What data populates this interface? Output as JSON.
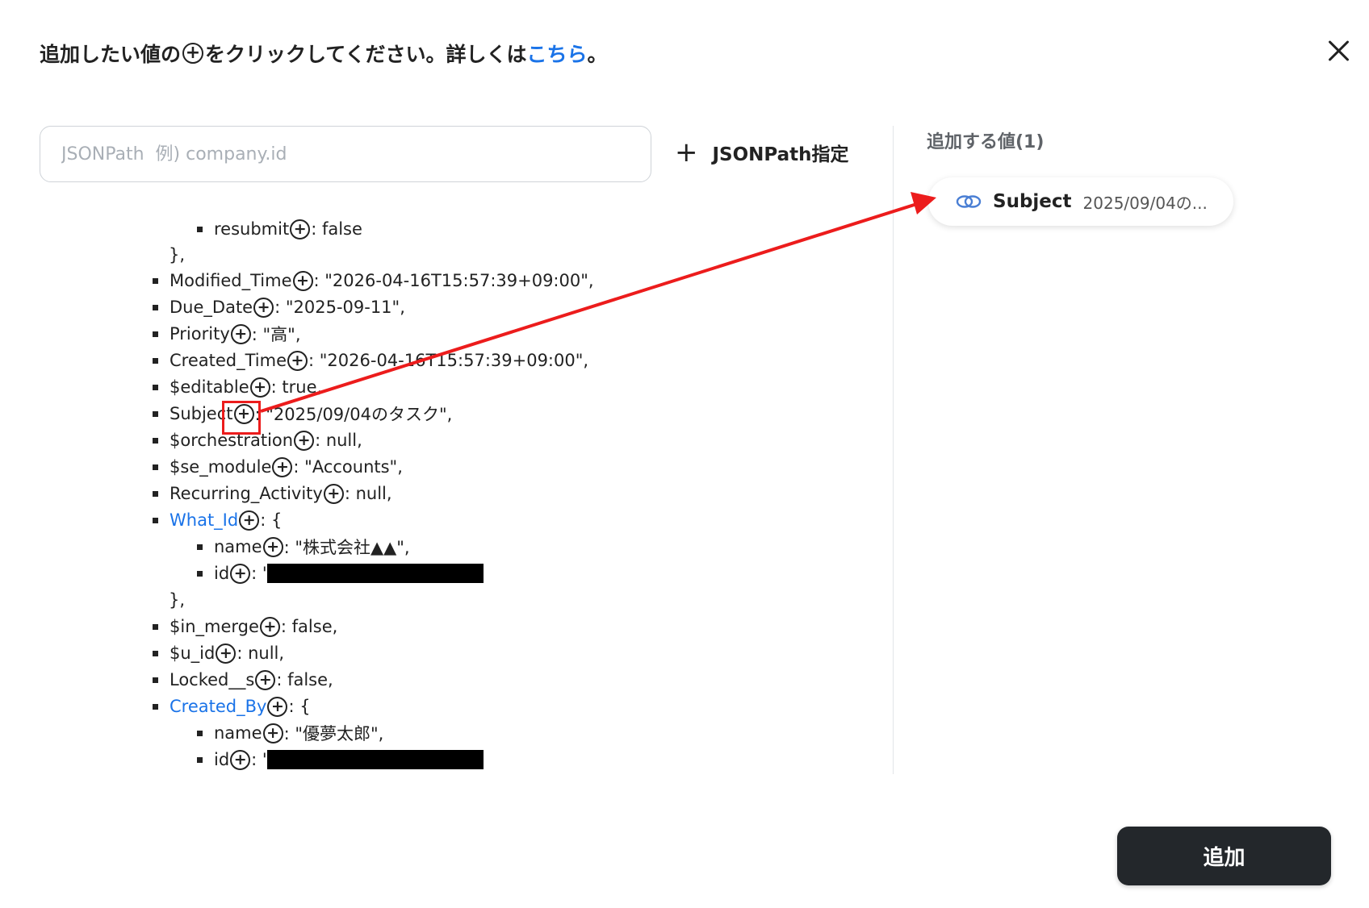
{
  "header": {
    "prefix": "追加したい値の",
    "plus_glyph": "+",
    "suffix": "をクリックしてください。詳しくは",
    "link": "こちら",
    "end": "。"
  },
  "search": {
    "placeholder": "JSONPath  例) company.id",
    "value": ""
  },
  "jsonpath_button": {
    "icon": "+",
    "label": "JSONPath指定"
  },
  "selected": {
    "title": "追加する値(1)",
    "chip": {
      "icon": "link-icon",
      "key": "Subject",
      "value": "2025/09/04の..."
    }
  },
  "tree": {
    "resubmit": {
      "key": "resubmit",
      "value": ": false"
    },
    "close1": "},",
    "modified_time": {
      "key": "Modified_Time",
      "value": ": \"2026-04-16T15:57:39+09:00\","
    },
    "due_date": {
      "key": "Due_Date",
      "value": ": \"2025-09-11\","
    },
    "priority": {
      "key": "Priority",
      "value": ": \"高\","
    },
    "created_time": {
      "key": "Created_Time",
      "value": ": \"2026-04-16T15:57:39+09:00\","
    },
    "editable": {
      "key": "$editable",
      "value": ": true,"
    },
    "subject": {
      "key": "Subject",
      "value": ": \"2025/09/04のタスク\","
    },
    "orchestration": {
      "key": "$orchestration",
      "value": ": null,"
    },
    "se_module": {
      "key": "$se_module",
      "value": ": \"Accounts\","
    },
    "recurring_activity": {
      "key": "Recurring_Activity",
      "value": ": null,"
    },
    "what_id": {
      "key": "What_Id",
      "value": ": {"
    },
    "what_id_name": {
      "key": "name",
      "value": ": \"株式会社▲▲\","
    },
    "what_id_id": {
      "key": "id",
      "value": ": '"
    },
    "close2": "},",
    "in_merge": {
      "key": "$in_merge",
      "value": ": false,"
    },
    "u_id": {
      "key": "$u_id",
      "value": ": null,"
    },
    "locked_s": {
      "key": "Locked__s",
      "value": ": false,"
    },
    "created_by": {
      "key": "Created_By",
      "value": ": {"
    },
    "created_by_name": {
      "key": "name",
      "value": ": \"優夢太郎\","
    },
    "created_by_id": {
      "key": "id",
      "value": ": '"
    }
  },
  "add_button": {
    "label": "追加"
  },
  "colors": {
    "accent": "#1a73e8",
    "annotation": "#ec1c1c",
    "button_bg": "#23272b"
  }
}
